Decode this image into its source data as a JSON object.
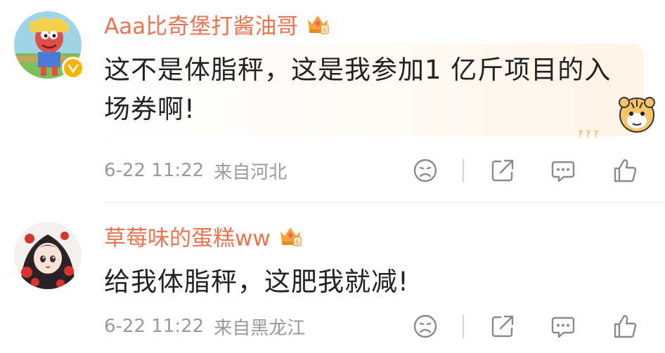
{
  "comments": [
    {
      "username": "Aaa比奇堡打酱油哥",
      "verified_icon": "verified-badge-icon",
      "level_badge": "6",
      "text": "这不是体脂秤，这是我参加1 亿斤项目的入场券啊!",
      "sticker_marks": "? ? ?",
      "time": "6-22 11:22",
      "source": "来自河北"
    },
    {
      "username": "草莓味的蛋糕ww",
      "level_badge": "6",
      "text": "给我体脂秤，这肥我就减!",
      "time": "6-22 11:22",
      "source": "来自黑龙江"
    }
  ],
  "colors": {
    "username": "#eb7350",
    "text": "#222222",
    "meta": "#999999",
    "icon": "#8a8a8a",
    "badge": "#f2a33a",
    "verified": "#f7b500"
  },
  "icons": [
    "sad-face-icon",
    "share-icon",
    "comment-icon",
    "thumbs-up-icon",
    "crown-badge-icon",
    "verified-badge-icon"
  ]
}
